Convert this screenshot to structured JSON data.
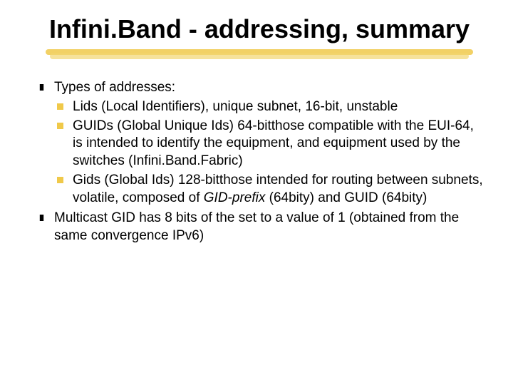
{
  "title": "Infini.Band - addressing, summary",
  "bullets": {
    "b1": "Types of addresses:",
    "b1a": "Lids (Local Identifiers), unique subnet, 16-bit, unstable",
    "b1b": "GUIDs (Global Unique Ids) 64-bitthose compatible with the EUI-64, is intended to identify the equipment, and equipment used by the switches (Infini.Band.Fabric)",
    "b1c_pre": "Gids (Global Ids) 128-bitthose intended for routing between subnets, volatile, composed of ",
    "b1c_italic": "GID-prefix",
    "b1c_post": " (64bity) and GUID (64bity)",
    "b2": "Multicast GID has 8 bits of the set to a value of 1 (obtained from the same convergence IPv6)"
  }
}
